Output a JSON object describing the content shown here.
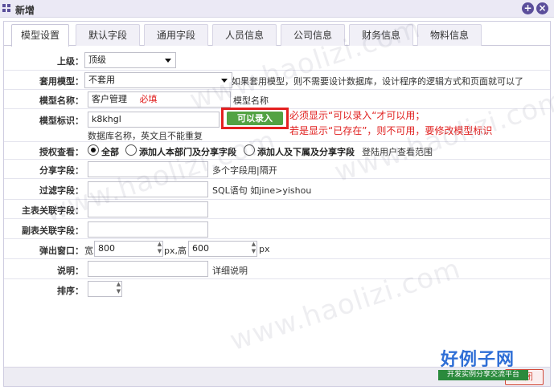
{
  "window": {
    "title": "新增"
  },
  "tabs": [
    {
      "label": "模型设置",
      "active": true
    },
    {
      "label": "默认字段",
      "active": false
    },
    {
      "label": "通用字段",
      "active": false
    },
    {
      "label": "人员信息",
      "active": false
    },
    {
      "label": "公司信息",
      "active": false
    },
    {
      "label": "财务信息",
      "active": false
    },
    {
      "label": "物料信息",
      "active": false
    }
  ],
  "form": {
    "parent": {
      "label": "上级：",
      "value": "顶级"
    },
    "template": {
      "label": "套用模型：",
      "value": "不套用",
      "hint": "如果套用模型，则不需要设计数据库，设计程序的逻辑方式和页面就可以了"
    },
    "model_name": {
      "label": "模型名称：",
      "value": "客户管理",
      "required_note": "必填",
      "hint": "模型名称"
    },
    "model_id": {
      "label": "模型标识：",
      "value": "k8khgl",
      "hint": "数据库名称，英文且不能重复",
      "check_button": "可以录入"
    },
    "annotation": {
      "line1": "必须显示“可以录入“才可以用；",
      "line2": "若是显示“已存在”，则不可用，要修改模型标识"
    },
    "auth": {
      "label": "授权查看：",
      "options": [
        "全部",
        "添加人本部门及分享字段",
        "添加人及下属及分享字段"
      ],
      "selected": 0,
      "hint": "登陆用户查看范围"
    },
    "share_field": {
      "label": "分享字段：",
      "value": "",
      "hint": "多个字段用|隔开"
    },
    "filter_field": {
      "label": "过滤字段：",
      "value": "",
      "hint": "SQL语句 如jine>yishou"
    },
    "main_key": {
      "label": "主表关联字段：",
      "value": ""
    },
    "sub_key": {
      "label": "副表关联字段：",
      "value": ""
    },
    "popup": {
      "label": "弹出窗口：",
      "width_label": "宽",
      "width": "800",
      "unit1": "px,高",
      "height": "600",
      "unit2": "px"
    },
    "desc": {
      "label": "说明：",
      "value": "",
      "hint": "详细说明"
    },
    "sort": {
      "label": "排序：",
      "value": ""
    }
  },
  "watermark": "www.haolizi.com",
  "logo": {
    "big": "好例子网",
    "small": "开发实例分享交流平台"
  },
  "close_label": "关闭"
}
